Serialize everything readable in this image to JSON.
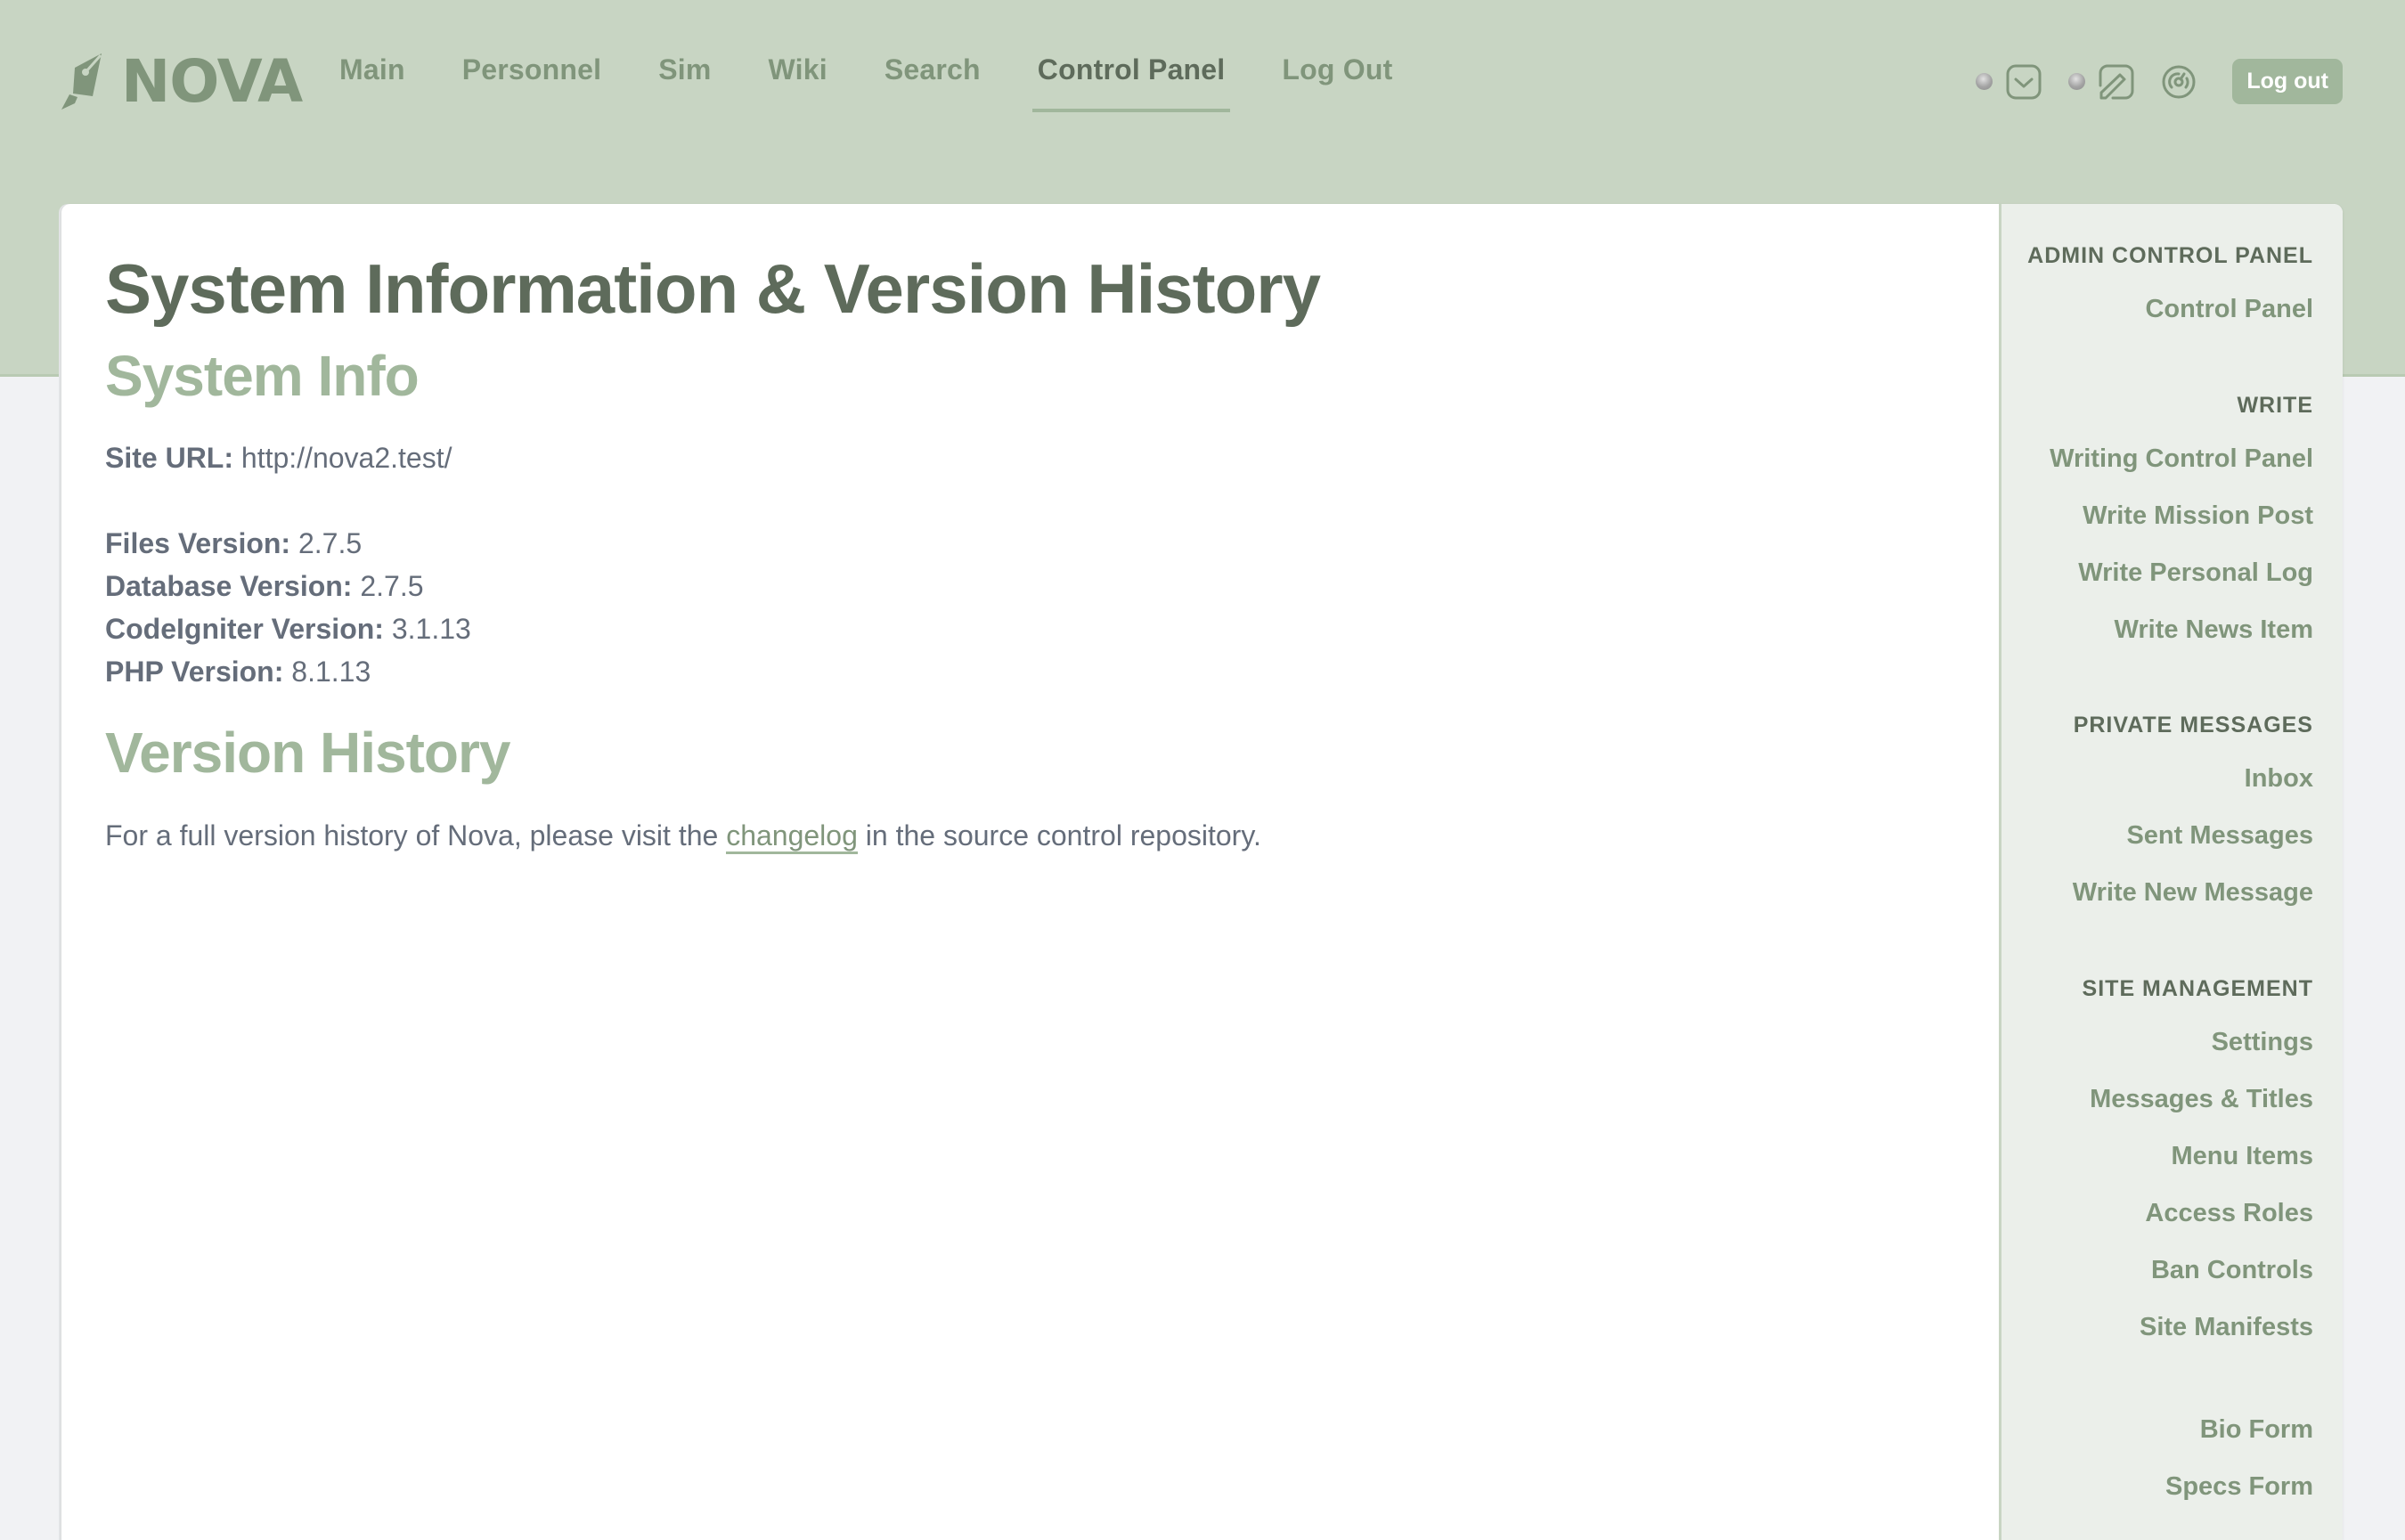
{
  "header": {
    "logo_text": "NOVA",
    "nav": [
      {
        "label": "Main",
        "active": false
      },
      {
        "label": "Personnel",
        "active": false
      },
      {
        "label": "Sim",
        "active": false
      },
      {
        "label": "Wiki",
        "active": false
      },
      {
        "label": "Search",
        "active": false
      },
      {
        "label": "Control Panel",
        "active": true
      },
      {
        "label": "Log Out",
        "active": false
      }
    ],
    "tools": {
      "messages_icon": "inbox-icon",
      "write_icon": "pencil-square-icon",
      "dashboard_icon": "gauge-icon",
      "logout_label": "Log out"
    }
  },
  "main": {
    "page_title": "System Information & Version History",
    "system_info_heading": "System Info",
    "site_url": {
      "label": "Site URL:",
      "value": "http://nova2.test/"
    },
    "versions": [
      {
        "label": "Files Version:",
        "value": "2.7.5"
      },
      {
        "label": "Database Version:",
        "value": "2.7.5"
      },
      {
        "label": "CodeIgniter Version:",
        "value": "3.1.13"
      },
      {
        "label": "PHP Version:",
        "value": "8.1.13"
      }
    ],
    "version_history_heading": "Version History",
    "history_text_before": "For a full version history of Nova, please visit the",
    "history_link": "changelog",
    "history_text_after": "in the source control repository."
  },
  "sidebar": {
    "groups": [
      {
        "heading": "ADMIN CONTROL PANEL",
        "items": [
          "Control Panel"
        ]
      },
      {
        "heading": "WRITE",
        "items": [
          "Writing Control Panel",
          "Write Mission Post",
          "Write Personal Log",
          "Write News Item"
        ]
      },
      {
        "heading": "PRIVATE MESSAGES",
        "items": [
          "Inbox",
          "Sent Messages",
          "Write New Message"
        ]
      },
      {
        "heading": "SITE MANAGEMENT",
        "items": [
          "Settings",
          "Messages & Titles",
          "Menu Items",
          "Access Roles",
          "Ban Controls",
          "Site Manifests"
        ]
      },
      {
        "heading": "",
        "items": [
          "Bio Form",
          "Specs Form"
        ]
      }
    ]
  },
  "colors": {
    "header_bg": "#c8d5c3",
    "accent": "#a1b79c",
    "link": "#80957b",
    "heading_dark": "#5e6b5b",
    "body_text": "#656d7a",
    "sidebar_bg": "#ebefea",
    "page_bg": "#f1f2f4"
  }
}
